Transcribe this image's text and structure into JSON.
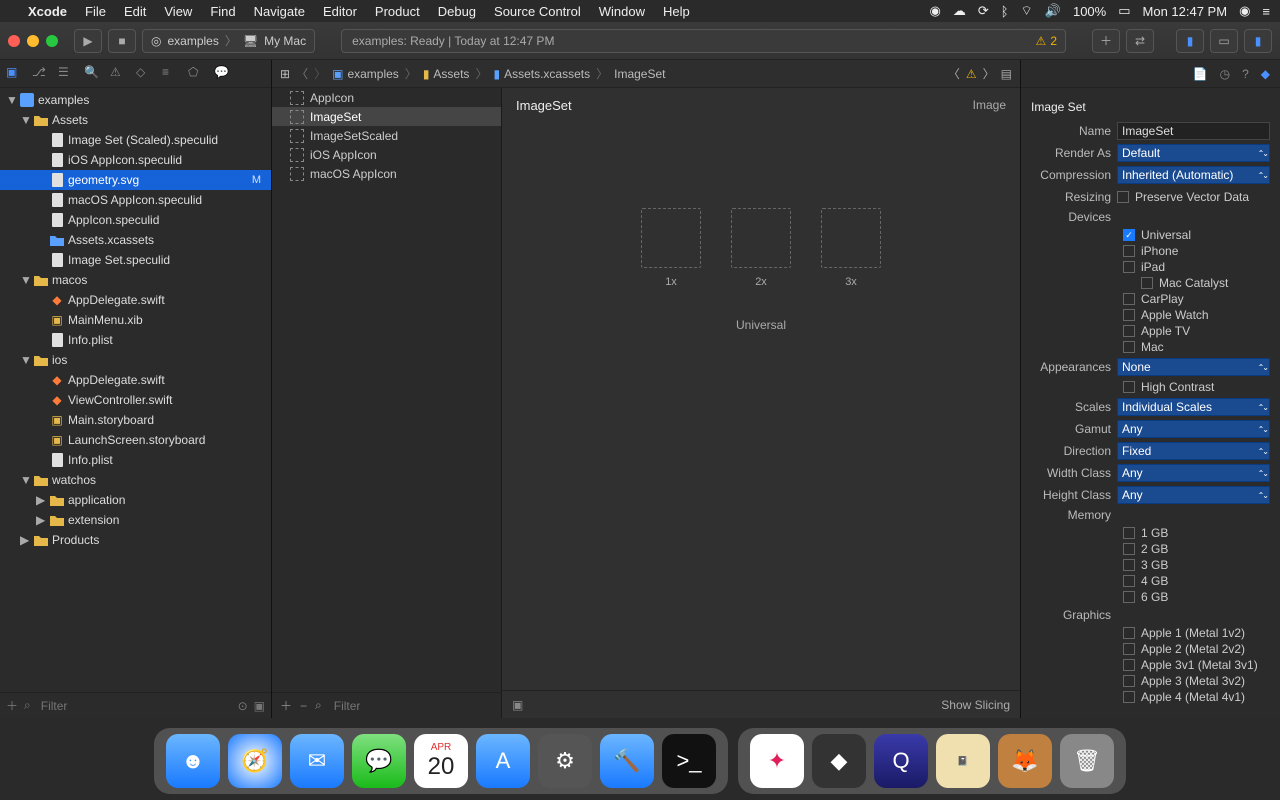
{
  "menubar": {
    "app": "Xcode",
    "items": [
      "File",
      "Edit",
      "View",
      "Find",
      "Navigate",
      "Editor",
      "Product",
      "Debug",
      "Source Control",
      "Window",
      "Help"
    ],
    "status": {
      "battery": "100%",
      "clock": "Mon 12:47 PM"
    }
  },
  "toolbar": {
    "scheme_target": "examples",
    "scheme_device": "My Mac",
    "status_text": "examples: Ready | Today at 12:47 PM",
    "warning_count": "2"
  },
  "breadcrumbs": [
    "examples",
    "Assets",
    "Assets.xcassets",
    "ImageSet"
  ],
  "navigator": {
    "root": "examples",
    "tree": [
      {
        "label": "examples",
        "kind": "project",
        "depth": 0,
        "open": true
      },
      {
        "label": "Assets",
        "kind": "folder",
        "depth": 1,
        "open": true
      },
      {
        "label": "Image Set (Scaled).speculid",
        "kind": "file",
        "depth": 2
      },
      {
        "label": "iOS AppIcon.speculid",
        "kind": "file",
        "depth": 2
      },
      {
        "label": "geometry.svg",
        "kind": "file",
        "depth": 2,
        "selected": true,
        "badge": "M"
      },
      {
        "label": "macOS AppIcon.speculid",
        "kind": "file",
        "depth": 2
      },
      {
        "label": "AppIcon.speculid",
        "kind": "file",
        "depth": 2
      },
      {
        "label": "Assets.xcassets",
        "kind": "folder-blue",
        "depth": 2
      },
      {
        "label": "Image Set.speculid",
        "kind": "file",
        "depth": 2
      },
      {
        "label": "macos",
        "kind": "folder",
        "depth": 1,
        "open": true
      },
      {
        "label": "AppDelegate.swift",
        "kind": "swift",
        "depth": 2
      },
      {
        "label": "MainMenu.xib",
        "kind": "xib",
        "depth": 2
      },
      {
        "label": "Info.plist",
        "kind": "file",
        "depth": 2
      },
      {
        "label": "ios",
        "kind": "folder",
        "depth": 1,
        "open": true
      },
      {
        "label": "AppDelegate.swift",
        "kind": "swift",
        "depth": 2
      },
      {
        "label": "ViewController.swift",
        "kind": "swift",
        "depth": 2
      },
      {
        "label": "Main.storyboard",
        "kind": "storyboard",
        "depth": 2
      },
      {
        "label": "LaunchScreen.storyboard",
        "kind": "storyboard",
        "depth": 2
      },
      {
        "label": "Info.plist",
        "kind": "file",
        "depth": 2
      },
      {
        "label": "watchos",
        "kind": "folder",
        "depth": 1,
        "open": true
      },
      {
        "label": "application",
        "kind": "folder",
        "depth": 2,
        "closed": true
      },
      {
        "label": "extension",
        "kind": "folder",
        "depth": 2,
        "closed": true
      },
      {
        "label": "Products",
        "kind": "folder",
        "depth": 1,
        "closed": true
      }
    ],
    "filter_placeholder": "Filter"
  },
  "asset_list": {
    "items": [
      "AppIcon",
      "ImageSet",
      "ImageSetScaled",
      "iOS AppIcon",
      "macOS AppIcon"
    ],
    "selected_index": 1,
    "filter_placeholder": "Filter"
  },
  "editor": {
    "title": "ImageSet",
    "type_label": "Image",
    "wells": [
      "1x",
      "2x",
      "3x"
    ],
    "group_label": "Universal",
    "show_slicing": "Show Slicing"
  },
  "inspector": {
    "section": "Image Set",
    "name_label": "Name",
    "name_value": "ImageSet",
    "render_as_label": "Render As",
    "render_as": "Default",
    "compression_label": "Compression",
    "compression": "Inherited (Automatic)",
    "resizing_label": "Resizing",
    "resizing_option": "Preserve Vector Data",
    "devices_label": "Devices",
    "devices": [
      {
        "label": "Universal",
        "checked": true
      },
      {
        "label": "iPhone",
        "checked": false
      },
      {
        "label": "iPad",
        "checked": false
      },
      {
        "label": "Mac Catalyst",
        "checked": false,
        "sub": true
      },
      {
        "label": "CarPlay",
        "checked": false
      },
      {
        "label": "Apple Watch",
        "checked": false
      },
      {
        "label": "Apple TV",
        "checked": false
      },
      {
        "label": "Mac",
        "checked": false
      }
    ],
    "appearances_label": "Appearances",
    "appearances": "None",
    "high_contrast_label": "High Contrast",
    "scales_label": "Scales",
    "scales": "Individual Scales",
    "gamut_label": "Gamut",
    "gamut": "Any",
    "direction_label": "Direction",
    "direction": "Fixed",
    "width_class_label": "Width Class",
    "width_class": "Any",
    "height_class_label": "Height Class",
    "height_class": "Any",
    "memory_label": "Memory",
    "memory": [
      "1 GB",
      "2 GB",
      "3 GB",
      "4 GB",
      "6 GB"
    ],
    "graphics_label": "Graphics",
    "graphics": [
      "Apple 1 (Metal 1v2)",
      "Apple 2 (Metal 2v2)",
      "Apple 3v1 (Metal 3v1)",
      "Apple 3 (Metal 3v2)",
      "Apple 4 (Metal 4v1)"
    ]
  },
  "dock": {
    "date_badge": {
      "month": "APR",
      "day": "20"
    },
    "apps": [
      "finder",
      "safari",
      "mail",
      "messages",
      "calendar",
      "appstore",
      "settings",
      "xcode",
      "terminal",
      "slack",
      "inkscape",
      "quicktime",
      "notes",
      "gimp",
      "trash"
    ]
  }
}
